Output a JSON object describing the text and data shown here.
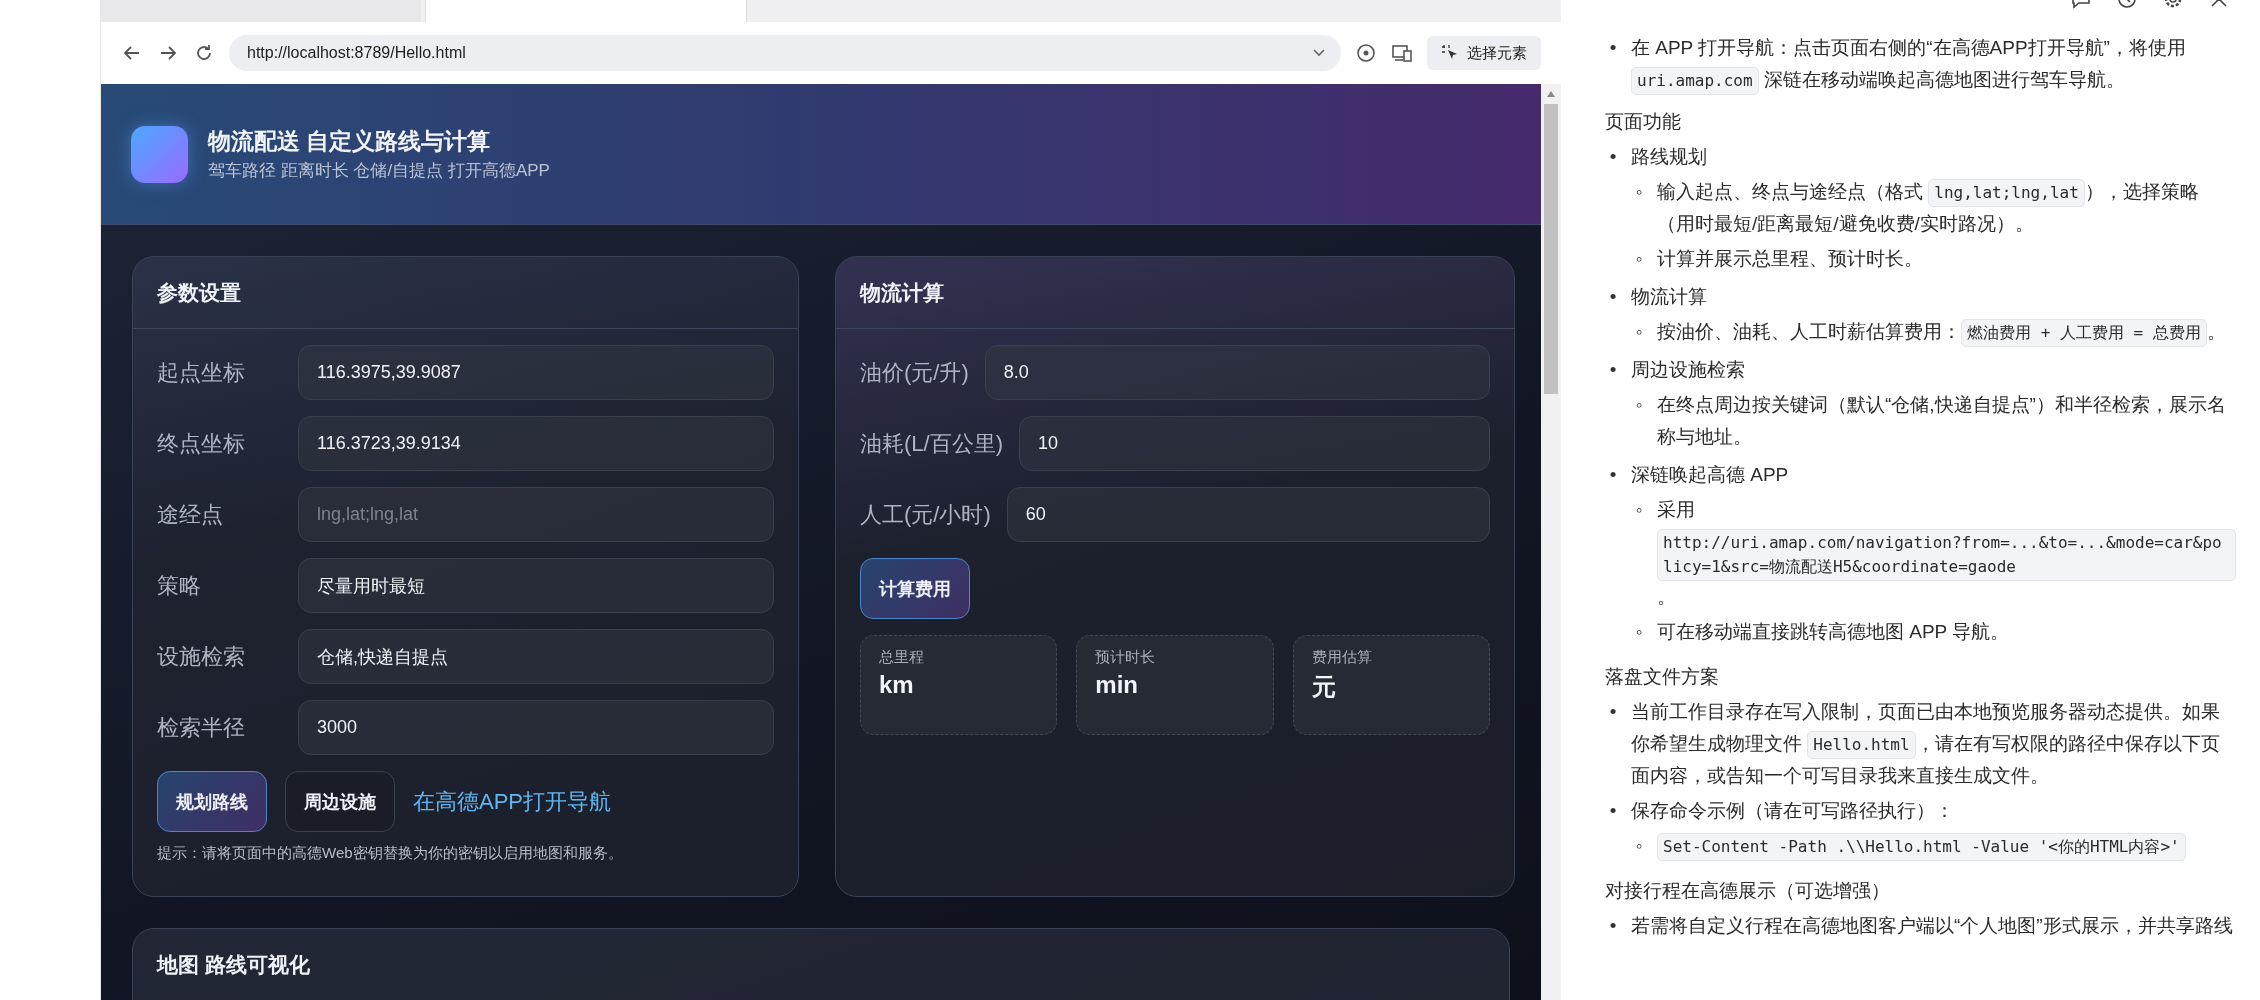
{
  "browser": {
    "tabs": [
      {
        "selected": false
      },
      {
        "selected": true
      }
    ],
    "url": "http://localhost:8789/Hello.html",
    "inspect_button": "选择元素"
  },
  "page": {
    "header": {
      "title": "物流配送 自定义路线与计算",
      "subtitle": "驾车路径 距离时长 仓储/自提点 打开高德APP"
    },
    "params": {
      "title": "参数设置",
      "fields": [
        {
          "label": "起点坐标",
          "value": "116.3975,39.9087"
        },
        {
          "label": "终点坐标",
          "value": "116.3723,39.9134"
        },
        {
          "label": "途经点",
          "placeholder": "lng,lat;lng,lat"
        },
        {
          "label": "策略",
          "value": "尽量用时最短"
        },
        {
          "label": "设施检索",
          "value": "仓储,快递自提点"
        },
        {
          "label": "检索半径",
          "value": "3000"
        }
      ],
      "buttons": [
        {
          "label": "规划路线",
          "kind": "primary"
        },
        {
          "label": "周边设施",
          "kind": "secondary"
        }
      ],
      "link": "在高德APP打开导航",
      "hint": "提示：请将页面中的高德Web密钥替换为你的密钥以启用地图和服务。"
    },
    "calc": {
      "title": "物流计算",
      "fields": [
        {
          "label": "油价(元/升)",
          "value": "8.0"
        },
        {
          "label": "油耗(L/百公里)",
          "value": "10"
        },
        {
          "label": "人工(元/小时)",
          "value": "60"
        }
      ],
      "button": "计算费用",
      "stats": [
        {
          "label": "总里程",
          "value": "km"
        },
        {
          "label": "预计时长",
          "value": "min"
        },
        {
          "label": "费用估算",
          "value": "元"
        }
      ]
    },
    "map": {
      "title": "地图 路线可视化"
    }
  },
  "assistant": {
    "blocks": [
      {
        "kind": "bullet",
        "marker": "•",
        "parts": [
          {
            "kind": "text",
            "text": "在 APP 打开导航：点击页面右侧的“在高德APP打开导航”，将使用 "
          },
          {
            "kind": "code",
            "text": "uri.amap.com"
          },
          {
            "kind": "text",
            "text": " 深链在移动端唤起高德地图进行驾车导航。"
          }
        ]
      },
      {
        "kind": "heading",
        "parts": [
          {
            "kind": "text",
            "text": "页面功能"
          }
        ]
      },
      {
        "kind": "bullet",
        "marker": "•",
        "parts": [
          {
            "kind": "text",
            "text": "路线规划"
          }
        ],
        "children": [
          {
            "marker": "◦",
            "parts": [
              {
                "kind": "text",
                "text": "输入起点、终点与途经点（格式 "
              },
              {
                "kind": "code",
                "text": "lng,lat;lng,lat"
              },
              {
                "kind": "text",
                "text": "），选择策略（用时最短/距离最短/避免收费/实时路况）。"
              }
            ]
          },
          {
            "marker": "◦",
            "parts": [
              {
                "kind": "text",
                "text": "计算并展示总里程、预计时长。"
              }
            ]
          }
        ]
      },
      {
        "kind": "bullet",
        "marker": "•",
        "parts": [
          {
            "kind": "text",
            "text": "物流计算"
          }
        ],
        "children": [
          {
            "marker": "◦",
            "parts": [
              {
                "kind": "text",
                "text": "按油价、油耗、人工时薪估算费用："
              },
              {
                "kind": "code",
                "text": "燃油费用 + 人工费用 = 总费用"
              },
              {
                "kind": "text",
                "text": "。"
              }
            ]
          }
        ]
      },
      {
        "kind": "bullet",
        "marker": "•",
        "parts": [
          {
            "kind": "text",
            "text": "周边设施检索"
          }
        ],
        "children": [
          {
            "marker": "◦",
            "parts": [
              {
                "kind": "text",
                "text": "在终点周边按关键词（默认“仓储,快递自提点”）和半径检索，展示名称与地址。"
              }
            ]
          }
        ]
      },
      {
        "kind": "bullet",
        "marker": "•",
        "parts": [
          {
            "kind": "text",
            "text": "深链唤起高德 APP"
          }
        ],
        "children": [
          {
            "marker": "◦",
            "parts": [
              {
                "kind": "text",
                "text": "采用 "
              },
              {
                "kind": "code",
                "text": "http://uri.amap.com/navigation?from=...&to=...&mode=car&policy=1&src=物流配送H5&coordinate=gaode"
              },
              {
                "kind": "text",
                "text": "。"
              }
            ]
          },
          {
            "marker": "◦",
            "parts": [
              {
                "kind": "text",
                "text": "可在移动端直接跳转高德地图 APP 导航。"
              }
            ]
          }
        ]
      },
      {
        "kind": "heading",
        "parts": [
          {
            "kind": "text",
            "text": "落盘文件方案"
          }
        ]
      },
      {
        "kind": "bullet",
        "marker": "•",
        "parts": [
          {
            "kind": "text",
            "text": "当前工作目录存在写入限制，页面已由本地预览服务器动态提供。如果你希望生成物理文件 "
          },
          {
            "kind": "code",
            "text": "Hello.html"
          },
          {
            "kind": "text",
            "text": "，请在有写权限的路径中保存以下页面内容，或告知一个可写目录我来直接生成文件。"
          }
        ]
      },
      {
        "kind": "bullet",
        "marker": "•",
        "parts": [
          {
            "kind": "text",
            "text": "保存命令示例（请在可写路径执行）："
          }
        ],
        "children": [
          {
            "marker": "◦",
            "parts": [
              {
                "kind": "code",
                "text": "Set-Content -Path .\\\\Hello.html -Value '<你的HTML内容>'"
              }
            ]
          }
        ]
      },
      {
        "kind": "heading",
        "parts": [
          {
            "kind": "text",
            "text": "对接行程在高德展示（可选增强）"
          }
        ]
      },
      {
        "kind": "bullet",
        "marker": "•",
        "parts": [
          {
            "kind": "text",
            "text": "若需将自定义行程在高德地图客户端以“个人地图”形式展示，并共享路线"
          }
        ]
      }
    ]
  }
}
